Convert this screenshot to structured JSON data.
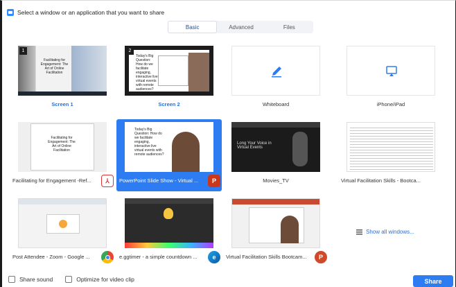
{
  "title": "Select a window or an application that you want to share",
  "tabs": [
    {
      "label": "Basic",
      "active": true
    },
    {
      "label": "Advanced",
      "active": false
    },
    {
      "label": "Files",
      "active": false
    }
  ],
  "items": [
    {
      "label": "Screen 1",
      "number": "1",
      "thumb_text": "Facilitating for Engagement: The Art of Online Facilitation"
    },
    {
      "label": "Screen 2",
      "number": "2",
      "thumb_text": "Today's Big Question: How do we facilitate engaging, interactive live virtual events with remote audiences?"
    },
    {
      "label": "Whiteboard",
      "icon": "pencil-icon"
    },
    {
      "label": "iPhone/iPad",
      "icon": "airplay-icon"
    },
    {
      "label": "Facilitating for Engagement -Ref...",
      "app": "pdf-icon",
      "thumb_text": "Facilitating for Engagement: The Art of Online Facilitation"
    },
    {
      "label": "PowerPoint Slide Show - Virtual ...",
      "app": "powerpoint-icon",
      "selected": true,
      "thumb_text": "Today's Big Question: How do we facilitate engaging, interactive live virtual events with remote audiences?"
    },
    {
      "label": "Movies_TV",
      "thumb_text": "Long Your Voice in Virtual Events"
    },
    {
      "label": "Virtual Facilitation Skills - Bootca...",
      "app": "document-icon"
    },
    {
      "label": "Post Attendee - Zoom - Google ...",
      "app": "chrome-icon"
    },
    {
      "label": "e.ggtimer - a simple countdown ...",
      "app": "edge-icon"
    },
    {
      "label": "Virtual Facilitation Skills Bootcam...",
      "app": "powerpoint-icon"
    }
  ],
  "show_all": "Show all windows...",
  "footer": {
    "share_sound": "Share sound",
    "optimize": "Optimize for video clip",
    "share_button": "Share"
  },
  "colors": {
    "accent": "#2d7cf2",
    "link": "#2d6fd3"
  }
}
